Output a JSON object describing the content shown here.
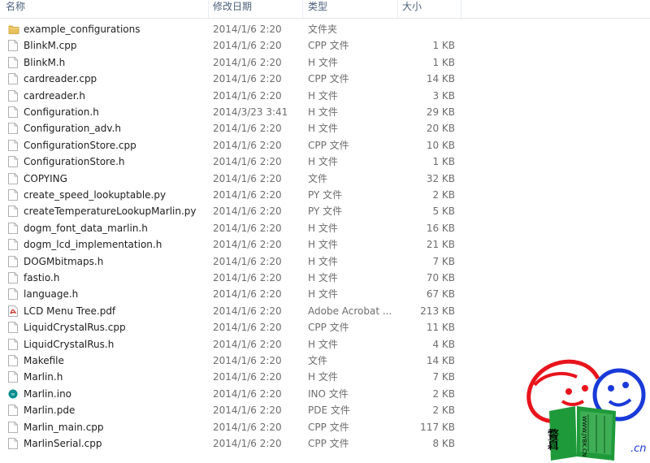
{
  "columns": {
    "name": "名称",
    "date": "修改日期",
    "type": "类型",
    "size": "大小"
  },
  "files": [
    {
      "name": "example_configurations",
      "date": "2014/1/6 2:20",
      "type": "文件夹",
      "size": "",
      "icon": "folder-icon"
    },
    {
      "name": "BlinkM.cpp",
      "date": "2014/1/6 2:20",
      "type": "CPP 文件",
      "size": "1 KB",
      "icon": "file-icon"
    },
    {
      "name": "BlinkM.h",
      "date": "2014/1/6 2:20",
      "type": "H 文件",
      "size": "1 KB",
      "icon": "file-icon"
    },
    {
      "name": "cardreader.cpp",
      "date": "2014/1/6 2:20",
      "type": "CPP 文件",
      "size": "14 KB",
      "icon": "file-icon"
    },
    {
      "name": "cardreader.h",
      "date": "2014/1/6 2:20",
      "type": "H 文件",
      "size": "3 KB",
      "icon": "file-icon"
    },
    {
      "name": "Configuration.h",
      "date": "2014/3/23 3:41",
      "type": "H 文件",
      "size": "29 KB",
      "icon": "file-icon"
    },
    {
      "name": "Configuration_adv.h",
      "date": "2014/1/6 2:20",
      "type": "H 文件",
      "size": "20 KB",
      "icon": "file-icon"
    },
    {
      "name": "ConfigurationStore.cpp",
      "date": "2014/1/6 2:20",
      "type": "CPP 文件",
      "size": "10 KB",
      "icon": "file-icon"
    },
    {
      "name": "ConfigurationStore.h",
      "date": "2014/1/6 2:20",
      "type": "H 文件",
      "size": "1 KB",
      "icon": "file-icon"
    },
    {
      "name": "COPYING",
      "date": "2014/1/6 2:20",
      "type": "文件",
      "size": "32 KB",
      "icon": "file-icon"
    },
    {
      "name": "create_speed_lookuptable.py",
      "date": "2014/1/6 2:20",
      "type": "PY 文件",
      "size": "2 KB",
      "icon": "file-icon"
    },
    {
      "name": "createTemperatureLookupMarlin.py",
      "date": "2014/1/6 2:20",
      "type": "PY 文件",
      "size": "5 KB",
      "icon": "file-icon"
    },
    {
      "name": "dogm_font_data_marlin.h",
      "date": "2014/1/6 2:20",
      "type": "H 文件",
      "size": "16 KB",
      "icon": "file-icon"
    },
    {
      "name": "dogm_lcd_implementation.h",
      "date": "2014/1/6 2:20",
      "type": "H 文件",
      "size": "21 KB",
      "icon": "file-icon"
    },
    {
      "name": "DOGMbitmaps.h",
      "date": "2014/1/6 2:20",
      "type": "H 文件",
      "size": "7 KB",
      "icon": "file-icon"
    },
    {
      "name": "fastio.h",
      "date": "2014/1/6 2:20",
      "type": "H 文件",
      "size": "70 KB",
      "icon": "file-icon"
    },
    {
      "name": "language.h",
      "date": "2014/1/6 2:20",
      "type": "H 文件",
      "size": "67 KB",
      "icon": "file-icon"
    },
    {
      "name": "LCD Menu Tree.pdf",
      "date": "2014/1/6 2:20",
      "type": "Adobe Acrobat ...",
      "size": "213 KB",
      "icon": "pdf-icon"
    },
    {
      "name": "LiquidCrystalRus.cpp",
      "date": "2014/1/6 2:20",
      "type": "CPP 文件",
      "size": "11 KB",
      "icon": "file-icon"
    },
    {
      "name": "LiquidCrystalRus.h",
      "date": "2014/1/6 2:20",
      "type": "H 文件",
      "size": "4 KB",
      "icon": "file-icon"
    },
    {
      "name": "Makefile",
      "date": "2014/1/6 2:20",
      "type": "文件",
      "size": "14 KB",
      "icon": "file-icon"
    },
    {
      "name": "Marlin.h",
      "date": "2014/1/6 2:20",
      "type": "H 文件",
      "size": "7 KB",
      "icon": "file-icon"
    },
    {
      "name": "Marlin.ino",
      "date": "2014/1/6 2:20",
      "type": "INO 文件",
      "size": "2 KB",
      "icon": "arduino-icon"
    },
    {
      "name": "Marlin.pde",
      "date": "2014/1/6 2:20",
      "type": "PDE 文件",
      "size": "2 KB",
      "icon": "file-icon"
    },
    {
      "name": "Marlin_main.cpp",
      "date": "2014/1/6 2:20",
      "type": "CPP 文件",
      "size": "117 KB",
      "icon": "file-icon"
    },
    {
      "name": "MarlinSerial.cpp",
      "date": "2014/1/6 2:20",
      "type": "CPP 文件",
      "size": "8 KB",
      "icon": "file-icon"
    }
  ],
  "watermark": {
    "book_chars": "教育百科",
    "spine_text": "WWW.JYBK.CN",
    "domain_suffix": ".cn"
  },
  "colors": {
    "header_text": "#4c607a",
    "folder": "#e8c15c",
    "pdf": "#c42b1c",
    "arduino": "#008c8c",
    "watermark_red": "#e8141c",
    "watermark_blue": "#1a3ad8",
    "watermark_green": "#1f9a3a"
  }
}
